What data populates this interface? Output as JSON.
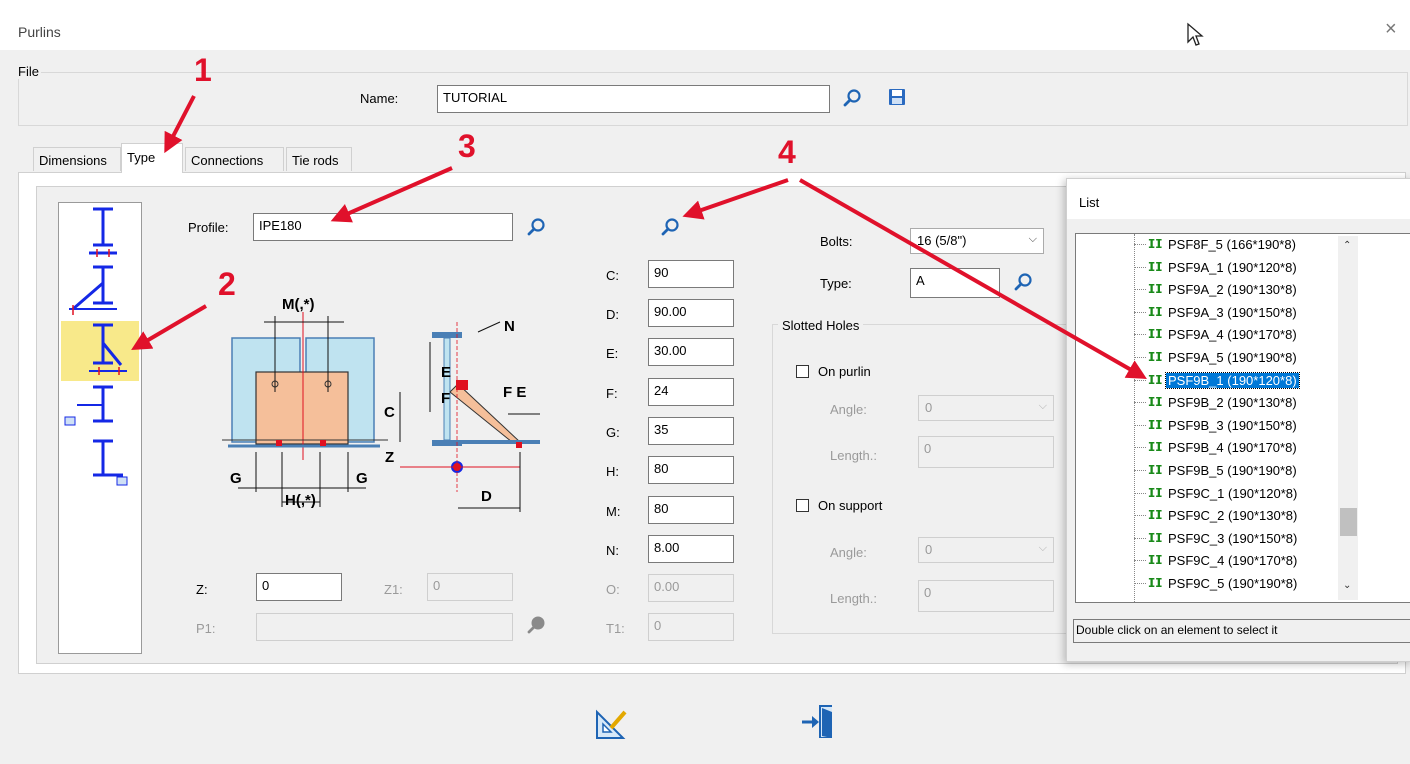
{
  "window": {
    "title": "Purlins",
    "close_glyph": "×"
  },
  "file": {
    "group_label": "File",
    "name_label": "Name:",
    "name_value": "TUTORIAL"
  },
  "tabs": [
    {
      "label": "Dimensions",
      "active": false
    },
    {
      "label": "Type",
      "active": true
    },
    {
      "label": "Connections",
      "active": false
    },
    {
      "label": "Tie rods",
      "active": false
    }
  ],
  "profile": {
    "label": "Profile:",
    "value": "IPE180"
  },
  "dims": [
    {
      "label": "C:",
      "value": "90",
      "disabled": false
    },
    {
      "label": "D:",
      "value": "90.00",
      "disabled": false
    },
    {
      "label": "E:",
      "value": "30.00",
      "disabled": false
    },
    {
      "label": "F:",
      "value": "24",
      "disabled": false
    },
    {
      "label": "G:",
      "value": "35",
      "disabled": false
    },
    {
      "label": "H:",
      "value": "80",
      "disabled": false
    },
    {
      "label": "M:",
      "value": "80",
      "disabled": false
    },
    {
      "label": "N:",
      "value": "8.00",
      "disabled": false
    },
    {
      "label": "O:",
      "value": "0.00",
      "disabled": true
    },
    {
      "label": "T1:",
      "value": "0",
      "disabled": true
    }
  ],
  "z": {
    "label": "Z:",
    "value": "0"
  },
  "z1": {
    "label": "Z1:",
    "value": "0"
  },
  "p1": {
    "label": "P1:",
    "value": ""
  },
  "diagram_labels": {
    "m": "M(,*)",
    "n": "N",
    "c": "C",
    "e": "E",
    "f": "F",
    "fe": "F E",
    "z": "Z",
    "g1": "G",
    "g2": "G",
    "h": "H(,*)",
    "d": "D"
  },
  "bolts": {
    "label": "Bolts:",
    "value": "16 (5/8\")"
  },
  "type": {
    "label": "Type:",
    "value": "A"
  },
  "slotted": {
    "group_label": "Slotted Holes",
    "on_purlin": {
      "label": "On purlin",
      "angle_label": "Angle:",
      "angle_value": "0",
      "length_label": "Length.:",
      "length_value": "0"
    },
    "on_support": {
      "label": "On support",
      "angle_label": "Angle:",
      "angle_value": "0",
      "length_label": "Length.:",
      "length_value": "0"
    }
  },
  "list_window": {
    "title": "List",
    "items": [
      "PSF8F_5 (166*190*8)",
      "PSF9A_1 (190*120*8)",
      "PSF9A_2 (190*130*8)",
      "PSF9A_3 (190*150*8)",
      "PSF9A_4 (190*170*8)",
      "PSF9A_5 (190*190*8)",
      "PSF9B_1 (190*120*8)",
      "PSF9B_2 (190*130*8)",
      "PSF9B_3 (190*150*8)",
      "PSF9B_4 (190*170*8)",
      "PSF9B_5 (190*190*8)",
      "PSF9C_1 (190*120*8)",
      "PSF9C_2 (190*130*8)",
      "PSF9C_3 (190*150*8)",
      "PSF9C_4 (190*170*8)",
      "PSF9C_5 (190*190*8)"
    ],
    "selected_index": 6,
    "status": "Double click on an element to select it"
  },
  "annotations": [
    "1",
    "2",
    "3",
    "4"
  ],
  "colors": {
    "arrow": "#e0112b",
    "accent": "#0078d7",
    "icon_blue": "#1e64b4",
    "highlight": "#f8e98a"
  }
}
